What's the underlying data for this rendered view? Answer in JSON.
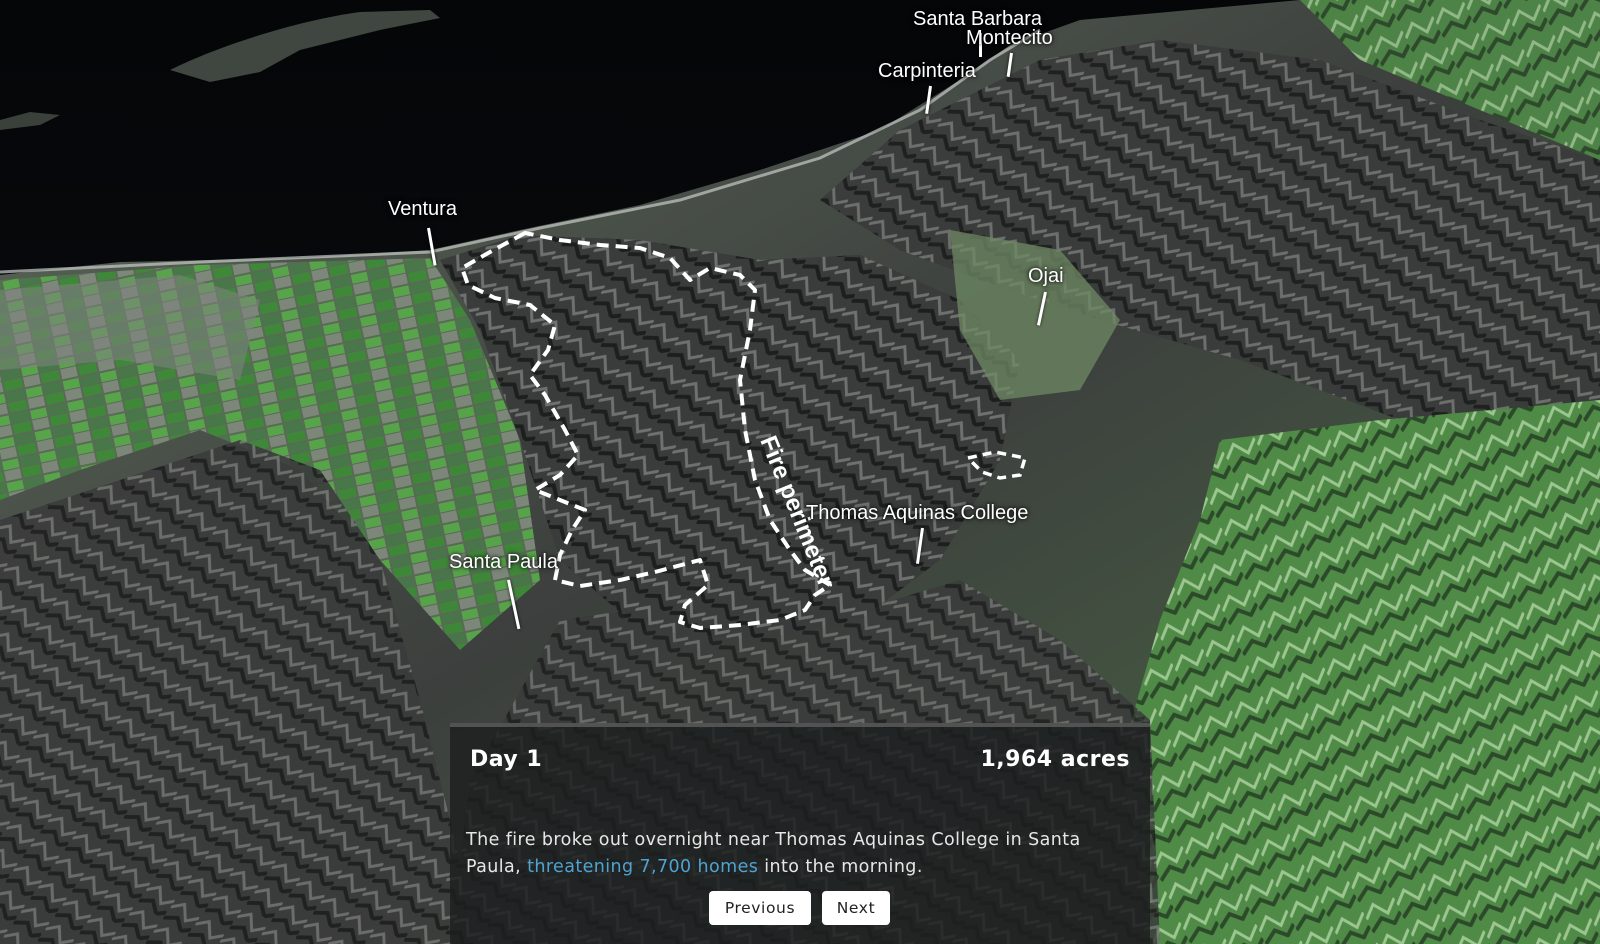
{
  "map": {
    "places": [
      {
        "id": "santa-barbara",
        "label": "Santa Barbara"
      },
      {
        "id": "montecito",
        "label": "Montecito"
      },
      {
        "id": "carpinteria",
        "label": "Carpinteria"
      },
      {
        "id": "ventura",
        "label": "Ventura"
      },
      {
        "id": "ojai",
        "label": "Ojai"
      },
      {
        "id": "thomas-aquinas-college",
        "label": "Thomas Aquinas College"
      },
      {
        "id": "santa-paula",
        "label": "Santa Paula"
      }
    ],
    "perimeter_label": "Fire perimeter",
    "colors": {
      "ocean": "#07090c",
      "terrain": "#3b3d3c",
      "vegetation": "#4f9a42",
      "perimeter": "#ffffff"
    }
  },
  "panel": {
    "day": "Day 1",
    "acres": "1,964 acres",
    "description_before": "The fire broke out overnight near Thomas Aquinas College in Santa Paula, ",
    "description_link": "threatening 7,700 homes",
    "description_after": " into the morning.",
    "link_color": "#4fa3d1",
    "previous_label": "Previous",
    "next_label": "Next"
  }
}
